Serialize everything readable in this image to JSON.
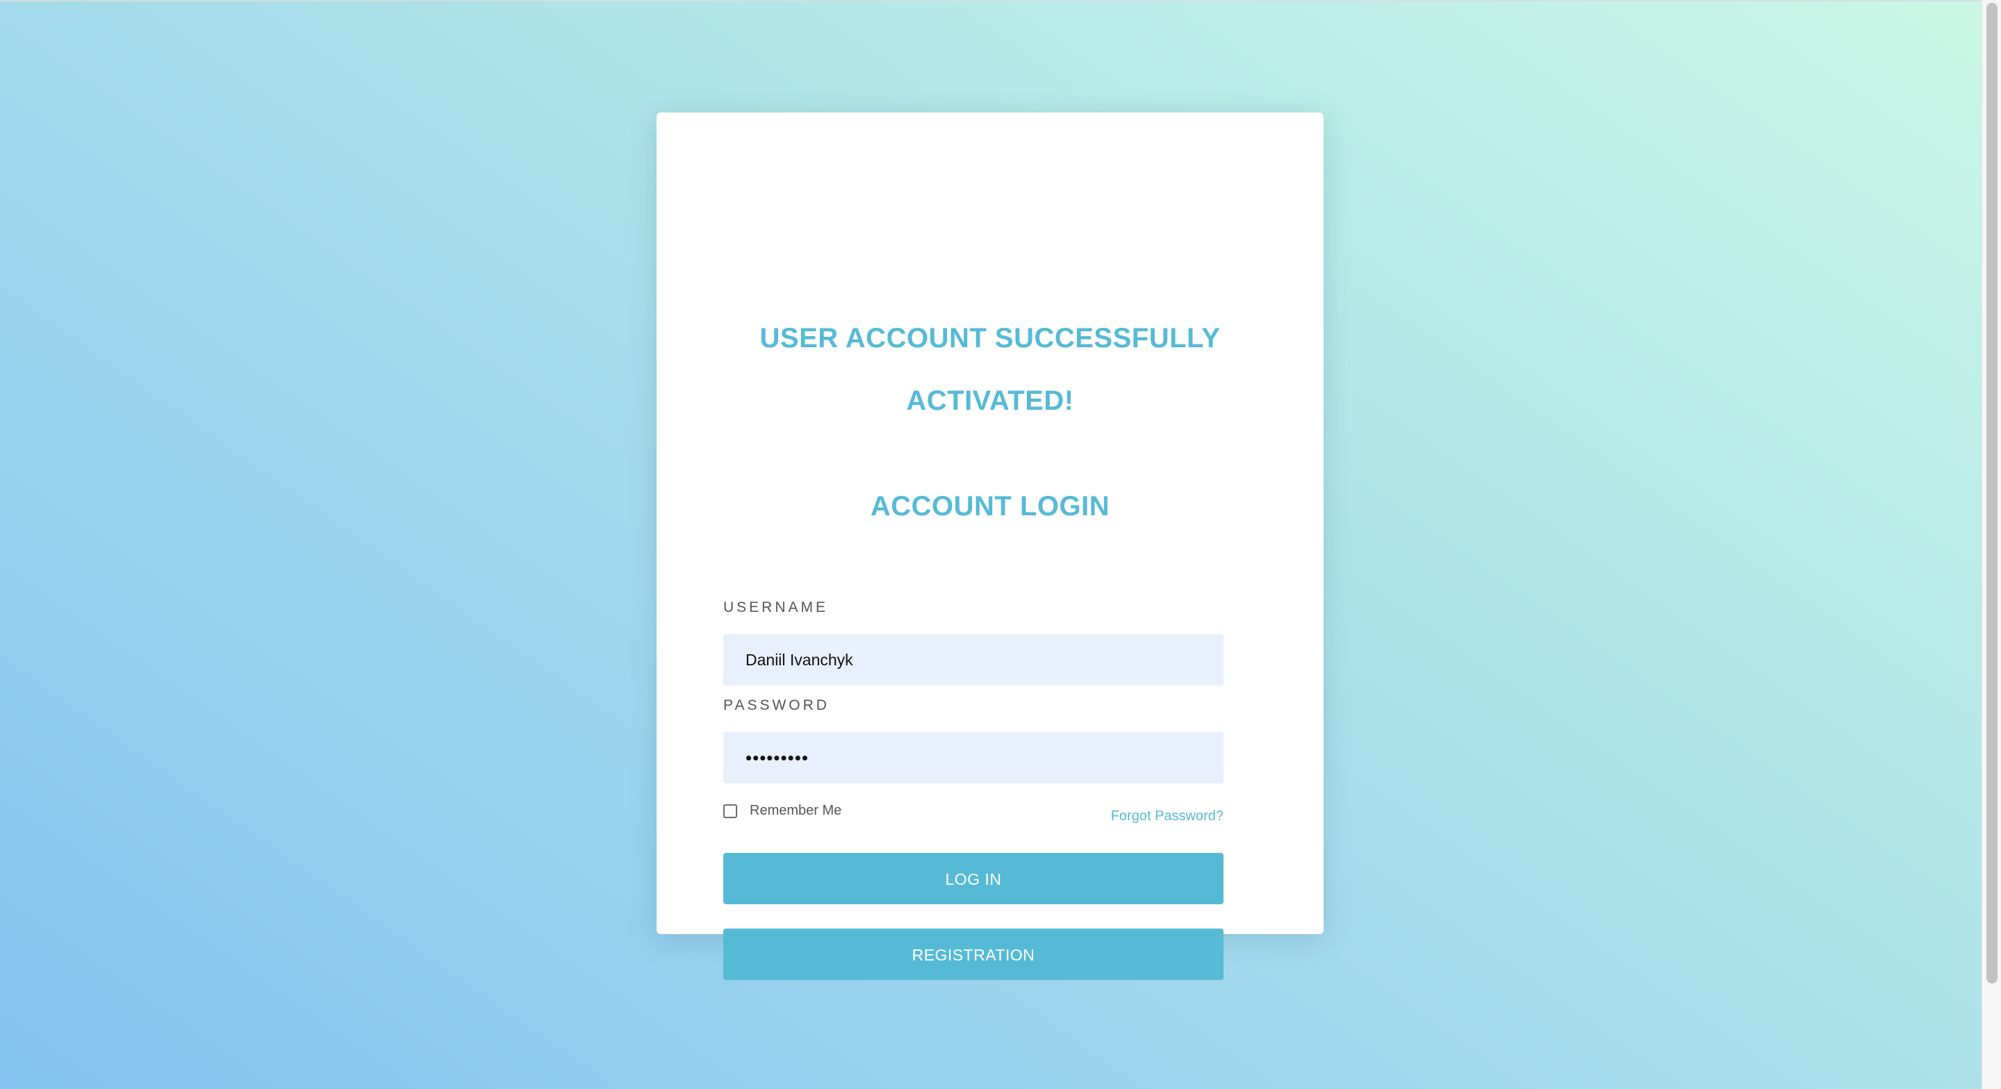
{
  "messages": {
    "success_line1": "USER ACCOUNT SUCCESSFULLY",
    "success_line2": "ACTIVATED!",
    "login_title": "ACCOUNT LOGIN"
  },
  "form": {
    "username_label": "USERNAME",
    "username_value": "Daniil Ivanchyk",
    "password_label": "PASSWORD",
    "password_value": "•••••••••",
    "remember_label": "Remember Me",
    "remember_checked": false,
    "forgot_link": "Forgot Password?",
    "login_button": "LOG IN",
    "register_button": "REGISTRATION"
  },
  "colors": {
    "accent": "#56bad6",
    "input_bg": "#e8f0fc",
    "card_bg": "#ffffff",
    "background_start": "#85c3f0",
    "background_end": "#ccf7e6"
  }
}
